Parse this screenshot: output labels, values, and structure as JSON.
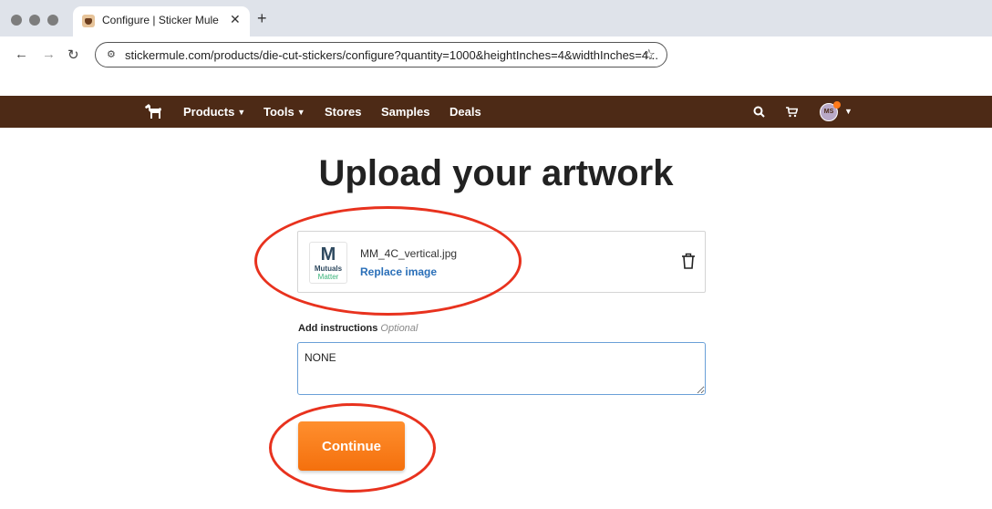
{
  "browser": {
    "tab_title": "Configure | Sticker Mule",
    "url": "stickermule.com/products/die-cut-stickers/configure?quantity=1000&heightInches=4&widthInches=4..."
  },
  "nav": {
    "items": [
      "Products",
      "Tools",
      "Stores",
      "Samples",
      "Deals"
    ],
    "avatar_initials": "MS"
  },
  "page": {
    "title": "Upload your artwork",
    "file": {
      "name": "MM_4C_vertical.jpg",
      "replace_label": "Replace image",
      "thumb_text_1": "Mutuals",
      "thumb_text_2": "Matter"
    },
    "instructions": {
      "label": "Add instructions",
      "optional": "Optional",
      "value": "NONE"
    },
    "continue_label": "Continue"
  },
  "colors": {
    "nav_bg": "#4d2a16",
    "accent_orange": "#f4700d",
    "link_blue": "#2a6fb8",
    "annotation_red": "#e8321e"
  }
}
